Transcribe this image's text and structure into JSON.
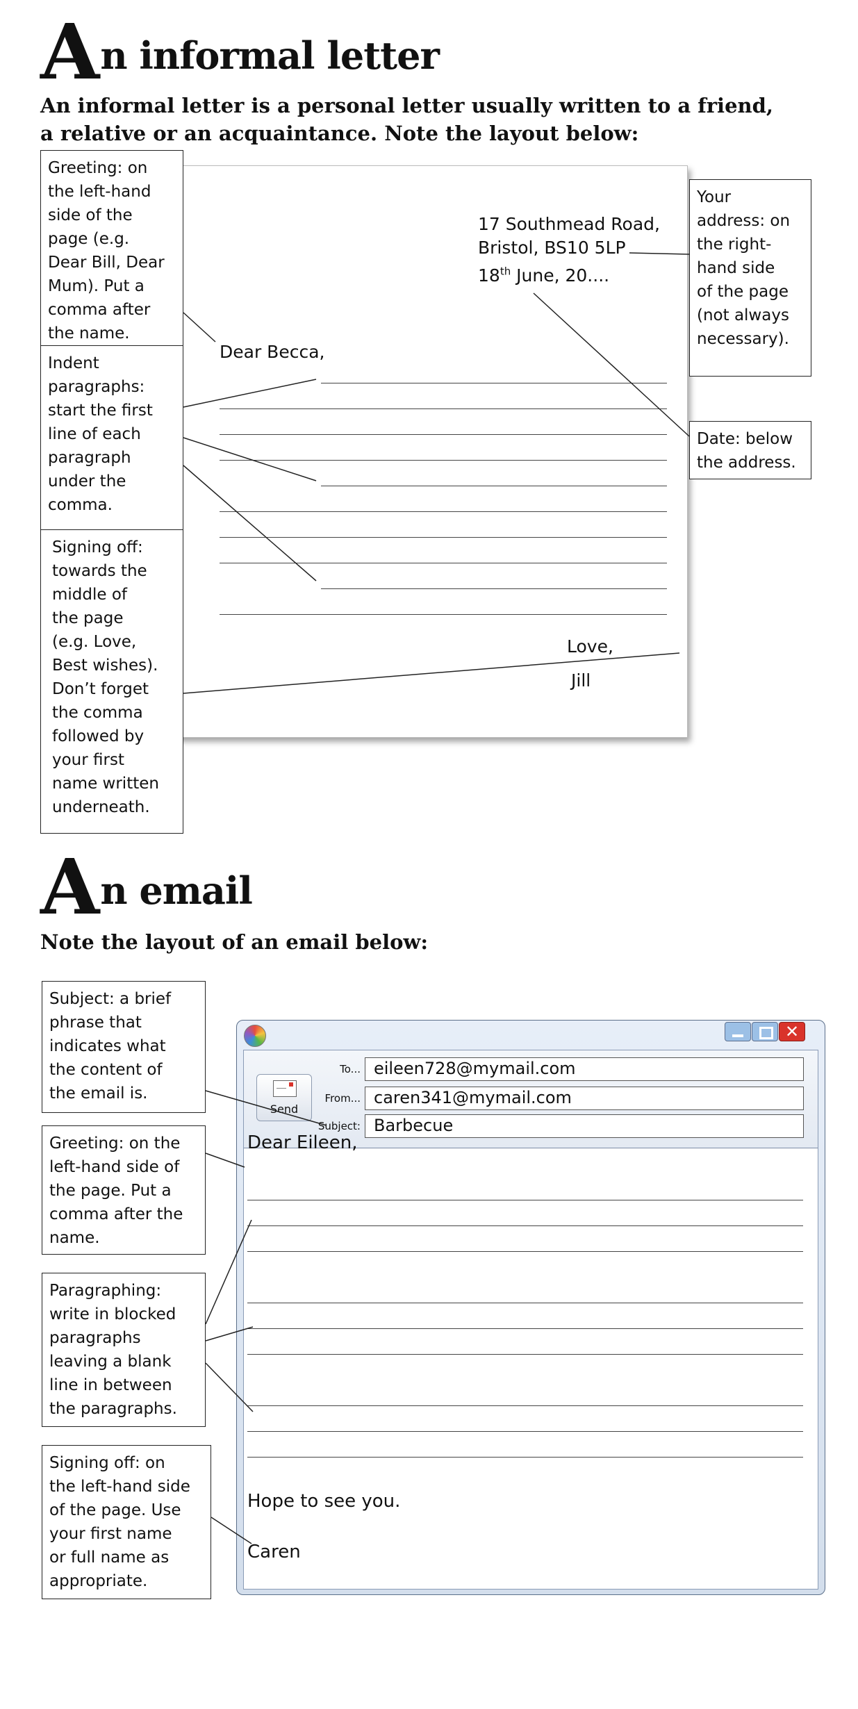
{
  "letter_section": {
    "heading_initial": "A",
    "heading_rest": "n informal letter",
    "intro": "An informal letter is a personal letter usually written to a friend, a relative or an acquaintance. Note the layout below:",
    "annotations": {
      "greeting": "Greeting: on\nthe left-hand\nside of the\npage (e.g.\nDear Bill, Dear\nMum). Put a\ncomma after\nthe name.",
      "indent": "Indent\nparagraphs:\nstart the first\nline of each\nparagraph\nunder the\ncomma.",
      "signing": "Signing off:\ntowards the\nmiddle of\nthe page\n(e.g. Love,\nBest wishes).\nDon’t forget\nthe comma\nfollowed by\nyour first\nname written\nunderneath.",
      "address": "Your\naddress: on\nthe right-\nhand side\nof the page\n(not always\nnecessary).",
      "date": "Date: below\nthe address."
    },
    "letter": {
      "address_line1": "17 Southmead Road,",
      "address_line2": "Bristol, BS10 5LP",
      "date_day": "18",
      "date_suffix": "th",
      "date_rest": " June, 20....",
      "greeting": "Dear Becca,",
      "closing": "Love,",
      "name": "Jill"
    }
  },
  "email_section": {
    "heading_initial": "A",
    "heading_rest": "n email",
    "intro": "Note the layout of an email below:",
    "annotations": {
      "subject": "Subject: a brief\nphrase that\nindicates what\nthe content of\nthe email is.",
      "greeting": "Greeting: on the\nleft-hand side of\nthe page. Put a\ncomma after the\nname.",
      "paragraphing": "Paragraphing:\nwrite in blocked\nparagraphs\nleaving a blank\nline in between\nthe paragraphs.",
      "signing": "Signing off: on\nthe left-hand side\nof the page. Use\nyour first name\nor full name as\nappropriate."
    },
    "window": {
      "send_label": "Send",
      "to_label": "To...",
      "from_label": "From...",
      "subject_label": "Subject:",
      "to_value": "eileen728@mymail.com",
      "from_value": "caren341@mymail.com",
      "subject_value": "Barbecue",
      "greeting": "Dear Eileen,",
      "closing": "Hope to see you.",
      "name": "Caren"
    }
  },
  "colors": {
    "close_button": "#d9332b",
    "window_button": "#9cc0e6",
    "window_border": "#5b6f8a"
  },
  "icons": [
    "app-orb-icon",
    "envelope-icon",
    "minimize-icon",
    "maximize-icon",
    "close-icon"
  ]
}
